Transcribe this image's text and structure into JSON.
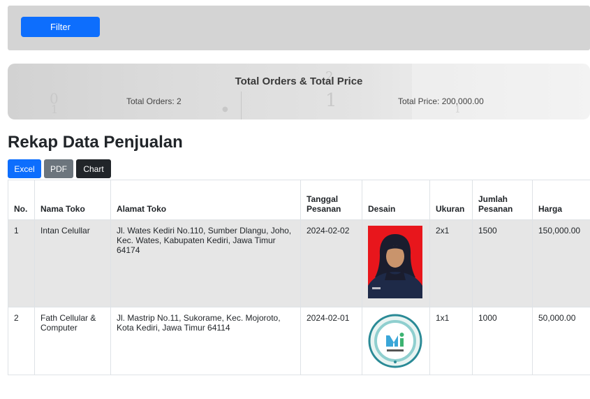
{
  "filter": {
    "button_label": "Filter",
    "colors": {
      "button": "#0d6efd",
      "bar": "#d4d4d4"
    }
  },
  "summary": {
    "title": "Total Orders & Total Price",
    "total_orders": "Total Orders: 2",
    "total_price": "Total Price: 200,000.00"
  },
  "page_title": "Rekap Data Penjualan",
  "export_buttons": {
    "excel": "Excel",
    "pdf": "PDF",
    "chart": "Chart"
  },
  "table": {
    "headers": [
      "No.",
      "Nama Toko",
      "Alamat Toko",
      "Tanggal Pesanan",
      "Desain",
      "Ukuran",
      "Jumlah Pesanan",
      "Harga"
    ],
    "rows": [
      {
        "no": "1",
        "nama_toko": "Intan Celullar",
        "alamat_toko": "Jl. Wates Kediri No.110, Sumber Dlangu, Joho, Kec. Wates, Kabupaten Kediri, Jawa Timur 64174",
        "tanggal": "2024-02-02",
        "desain": "portrait-photo",
        "ukuran": "2x1",
        "jumlah": "1500",
        "harga": "150,000.00"
      },
      {
        "no": "2",
        "nama_toko": "Fath Cellular & Computer",
        "alamat_toko": "Jl. Mastrip No.11, Sukorame, Kec. Mojoroto, Kota Kediri, Jawa Timur 64114",
        "tanggal": "2024-02-01",
        "desain": "circular-logo",
        "ukuran": "1x1",
        "jumlah": "1000",
        "harga": "50,000.00"
      }
    ]
  }
}
